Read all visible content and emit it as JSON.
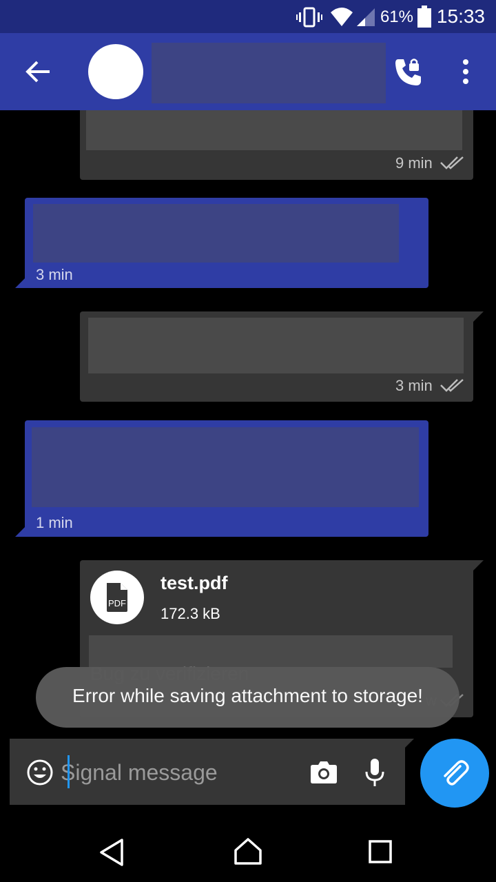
{
  "status_bar": {
    "battery_percent": "61%",
    "time": "15:33",
    "icons": [
      "vibrate-icon",
      "wifi-icon",
      "signal-icon",
      "battery-icon"
    ]
  },
  "app_bar": {
    "back_icon": "back-arrow-icon",
    "call_icon": "secure-call-icon",
    "menu_icon": "overflow-menu-icon"
  },
  "messages": [
    {
      "direction": "outgoing",
      "time": "9 min",
      "delivered": true
    },
    {
      "direction": "incoming",
      "time": "3 min"
    },
    {
      "direction": "outgoing",
      "time": "3 min",
      "delivered": true
    },
    {
      "direction": "incoming",
      "time": "1 min"
    },
    {
      "direction": "outgoing",
      "attachment": {
        "icon_label": "PDF",
        "file_name": "test.pdf",
        "file_size": "172.3 kB"
      },
      "caption": "Bug zu verifizieren",
      "time_partial": "w",
      "delivered": true
    }
  ],
  "toast": {
    "text": "Error while saving attachment to storage!"
  },
  "composer": {
    "placeholder": "Signal message",
    "emoji_icon": "emoji-icon",
    "camera_icon": "camera-icon",
    "mic_icon": "microphone-icon",
    "attach_icon": "paperclip-icon"
  },
  "nav_bar": {
    "icons": [
      "back-triangle-icon",
      "home-icon",
      "recents-icon"
    ]
  },
  "colors": {
    "primary_dark": "#1f2a7d",
    "primary": "#2f3da5",
    "accent": "#2196f3",
    "outgoing_bubble": "#363636"
  }
}
